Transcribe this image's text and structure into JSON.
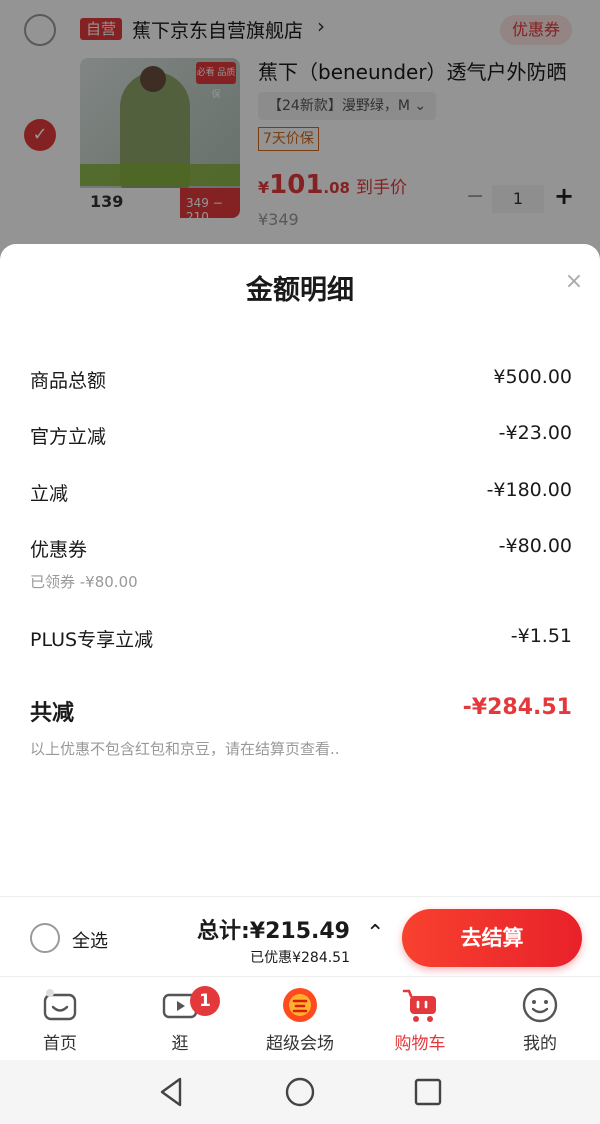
{
  "cart": {
    "shop_badge": "自营",
    "shop_name": "蕉下京东自营旗舰店",
    "shop_chevron": "›",
    "coupon_tag": "优惠券",
    "product_title": "蕉下（beneunder）透气户外防晒",
    "sku": "【24新款】漫野绿，M  ⌄",
    "return_tag": "7天价保",
    "price_currency": "¥",
    "price_int": "101",
    "price_dec": ".08",
    "price_suffix": "到手价",
    "orig_price": "¥349",
    "quantity": "1",
    "minus": "−",
    "plus": "+",
    "image_hot": "必看 品质保",
    "image_price": "139",
    "image_price2": "349 − 210"
  },
  "sheet": {
    "title": "金额明细",
    "close": "×",
    "rows": [
      {
        "label": "商品总额",
        "value": "¥500.00"
      },
      {
        "label": "官方立减",
        "value": "-¥23.00"
      },
      {
        "label": "立减",
        "value": "-¥180.00"
      },
      {
        "label": "优惠券",
        "value": "-¥80.00",
        "sub": "已领券 -¥80.00"
      },
      {
        "label": "PLUS专享立减",
        "value": "-¥1.51"
      }
    ],
    "total": {
      "label": "共减",
      "value": "-¥284.51"
    },
    "note": "以上优惠不包含红包和京豆，请在结算页查看.."
  },
  "checkout": {
    "select_all": "全选",
    "total": "总计:¥215.49",
    "saved": "已优惠¥284.51",
    "caret": "⌃",
    "pay": "去结算"
  },
  "tabs": [
    {
      "label": "首页",
      "icon": "home-icon"
    },
    {
      "label": "逛",
      "icon": "video-icon",
      "badge": "1"
    },
    {
      "label": "超级会场",
      "icon": "super-venue-icon"
    },
    {
      "label": "购物车",
      "icon": "cart-icon",
      "active": true
    },
    {
      "label": "我的",
      "icon": "profile-icon"
    }
  ],
  "colors": {
    "accent": "#e4393c",
    "muted": "#999999"
  }
}
